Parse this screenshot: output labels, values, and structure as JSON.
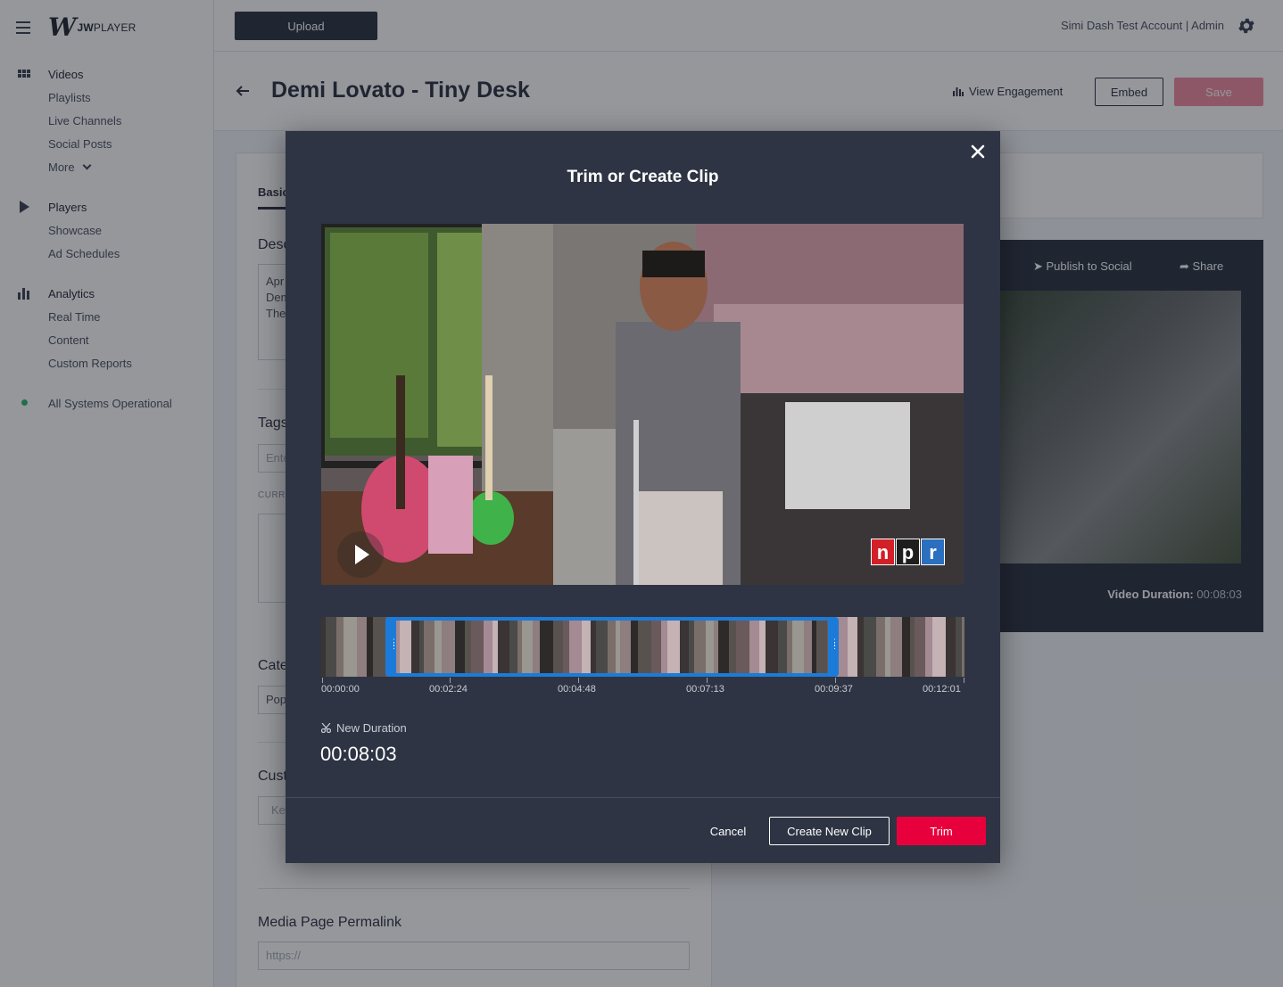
{
  "brand": {
    "logo_mark": "W",
    "logo_text_bold": "JW",
    "logo_text": "PLAYER"
  },
  "sidebar": {
    "sections": [
      {
        "head": "Videos",
        "icon": "grid-icon",
        "items": [
          "Playlists",
          "Live Channels",
          "Social Posts",
          "More"
        ]
      },
      {
        "head": "Players",
        "icon": "play-icon",
        "items": [
          "Showcase",
          "Ad Schedules"
        ]
      },
      {
        "head": "Analytics",
        "icon": "bar-chart-icon",
        "items": [
          "Real Time",
          "Content",
          "Custom Reports"
        ]
      }
    ],
    "status": "All Systems Operational",
    "status_color": "#2bb673"
  },
  "topbar": {
    "upload_label": "Upload",
    "account": "Simi Dash Test Account | Admin"
  },
  "page": {
    "title": "Demi Lovato - Tiny Desk",
    "view_engagement": "View Engagement",
    "embed": "Embed",
    "save": "Save"
  },
  "form": {
    "tab": "Basic",
    "description_label": "Desc",
    "description_lines": [
      "Apr",
      "Dem",
      "The"
    ],
    "tags_label": "Tags",
    "tags_placeholder": "Ente",
    "current_label": "CURR",
    "category_label": "Cate",
    "category_value": "Pop",
    "custom_label": "Cust",
    "custom_placeholder": "Ke",
    "permalink_label": "Media Page Permalink",
    "permalink_placeholder": "https://"
  },
  "right_panel": {
    "publish_social": "Publish to Social",
    "share": "Share",
    "video_duration_label": "Video Duration:",
    "video_duration_value": "00:08:03"
  },
  "modal": {
    "title": "Trim or Create Clip",
    "timeline_ticks": [
      "00:00:00",
      "00:02:24",
      "00:04:48",
      "00:07:13",
      "00:09:37",
      "00:12:01"
    ],
    "new_duration_label": "New Duration",
    "new_duration_value": "00:08:03",
    "cancel": "Cancel",
    "create_clip": "Create New Clip",
    "trim": "Trim",
    "accent_color": "#1c7bd9",
    "trim_color": "#e8003d",
    "npr_letters": [
      "n",
      "p",
      "r"
    ]
  }
}
